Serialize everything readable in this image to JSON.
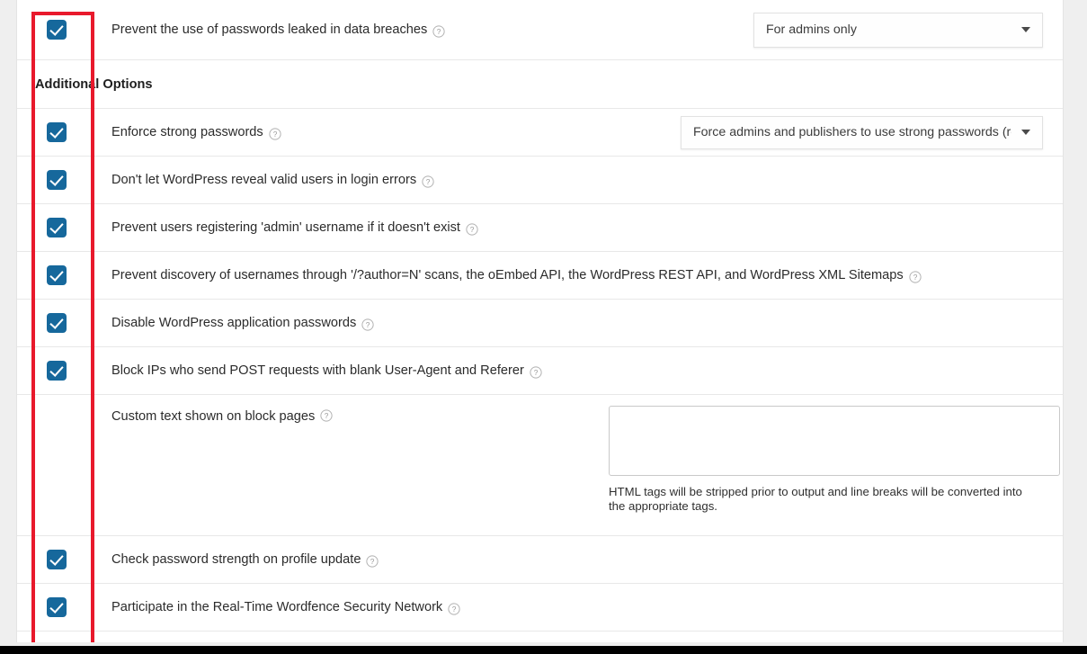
{
  "colors": {
    "checkbox_blue": "#16689c",
    "annotation_red": "#e8192c",
    "page_background": "#efefef",
    "card_background": "#ffffff",
    "divider": "#e8e8e8"
  },
  "section_header": {
    "title": "Additional Options"
  },
  "rows": [
    {
      "id": "prevent-leaked-passwords",
      "checked": true,
      "label": "Prevent the use of passwords leaked in data breaches",
      "help_icon": "help-circle-icon",
      "control": {
        "type": "select",
        "value": "For admins only",
        "caret_icon": "chevron-down-icon"
      }
    },
    {
      "id": "enforce-strong-passwords",
      "checked": true,
      "label": "Enforce strong passwords",
      "help_icon": "help-circle-icon",
      "control": {
        "type": "select",
        "value": "Force admins and publishers to use strong passwords (recomm…",
        "caret_icon": "chevron-down-icon"
      }
    },
    {
      "id": "hide-valid-users-login-errors",
      "checked": true,
      "label": "Don't let WordPress reveal valid users in login errors",
      "help_icon": "help-circle-icon",
      "control": null
    },
    {
      "id": "prevent-admin-registration",
      "checked": true,
      "label": "Prevent users registering 'admin' username if it doesn't exist",
      "help_icon": "help-circle-icon",
      "control": null
    },
    {
      "id": "prevent-username-discovery",
      "checked": true,
      "label": "Prevent discovery of usernames through '/?author=N' scans, the oEmbed API, the WordPress REST API, and WordPress XML Sitemaps",
      "help_icon": "help-circle-icon",
      "control": null
    },
    {
      "id": "disable-application-passwords",
      "checked": true,
      "label": "Disable WordPress application passwords",
      "help_icon": "help-circle-icon",
      "control": null
    },
    {
      "id": "block-blank-user-agent-post",
      "checked": true,
      "label": "Block IPs who send POST requests with blank User-Agent and Referer",
      "help_icon": "help-circle-icon",
      "control": null
    },
    {
      "id": "custom-block-page-text",
      "checked": false,
      "label": "Custom text shown on block pages",
      "help_icon": "help-circle-icon",
      "control": {
        "type": "textarea",
        "value": "",
        "placeholder": "",
        "hint": "HTML tags will be stripped prior to output and line breaks will be converted into the appropriate tags."
      }
    },
    {
      "id": "check-password-strength-profile-update",
      "checked": true,
      "label": "Check password strength on profile update",
      "help_icon": "help-circle-icon",
      "control": null
    },
    {
      "id": "participate-security-network",
      "checked": true,
      "label": "Participate in the Real-Time Wordfence Security Network",
      "help_icon": "help-circle-icon",
      "control": null
    }
  ],
  "annotation": {
    "name": "red-highlight-rectangle",
    "description": "Red rectangle outlining the checkbox column"
  }
}
